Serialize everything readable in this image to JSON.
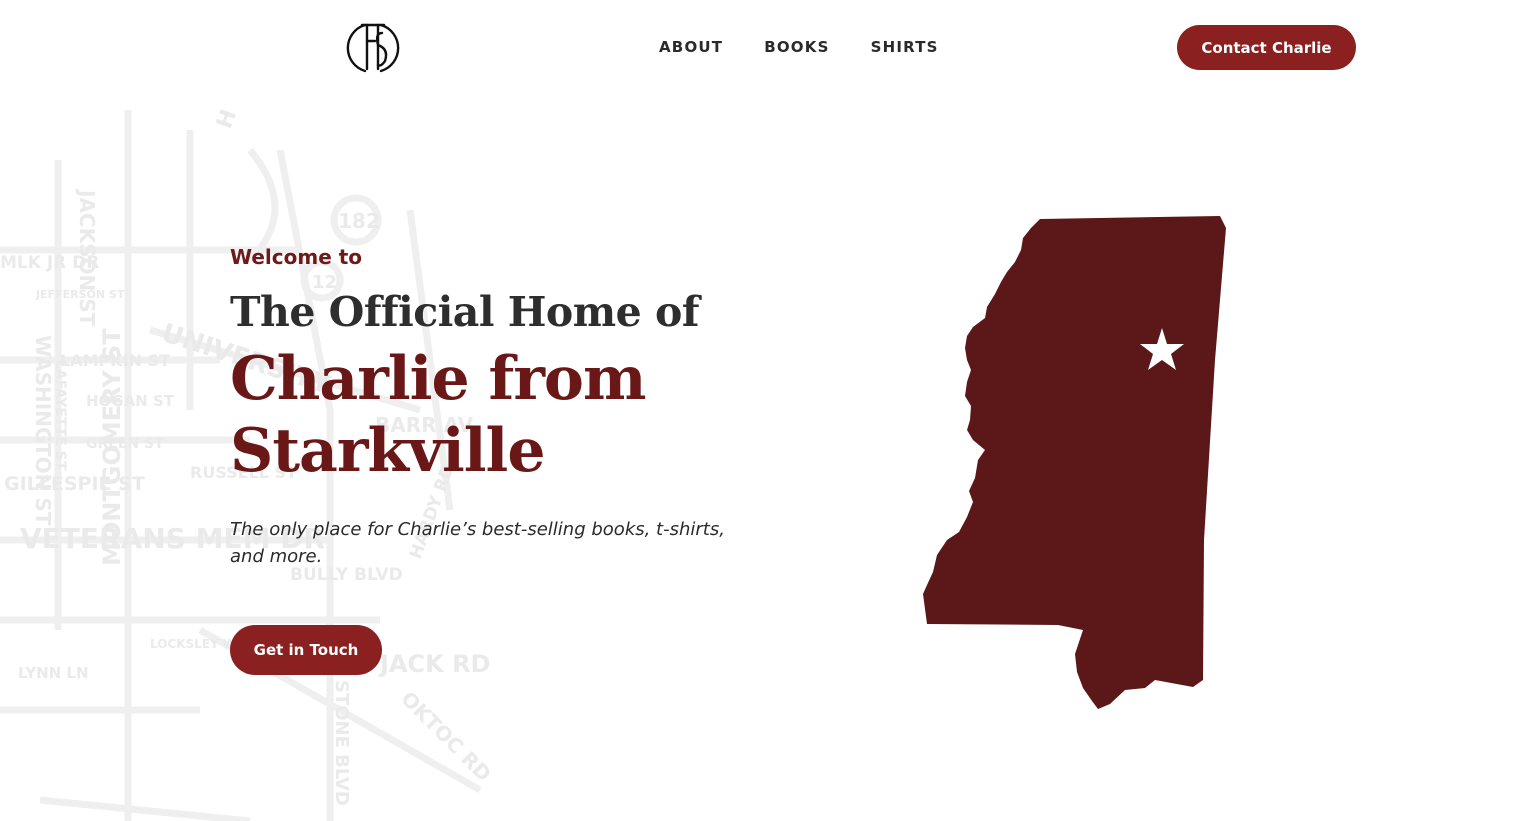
{
  "header": {
    "logo_icon": "cfs-monogram-logo-icon",
    "nav": [
      {
        "label": "ABOUT"
      },
      {
        "label": "BOOKS"
      },
      {
        "label": "SHIRTS"
      }
    ],
    "contact_button": "Contact Charlie"
  },
  "hero": {
    "eyebrow": "Welcome to",
    "title_line1": "The Official Home of",
    "title_line2": "Charlie from",
    "title_line3": "Starkville",
    "tagline": "The only place for Charlie’s best-selling books, t-shirts, and more.",
    "cta_button": "Get in Touch"
  },
  "background_map": {
    "street_labels": [
      "JACKSON ST",
      "MLK JR DR",
      "JEFFERSON ST",
      "HOLLYWEST POINT RD",
      "182",
      "UNIVERSITY",
      "12",
      "LAMPKIN ST",
      "WASHINGTON ST",
      "LAFAYETTE ST",
      "HOGAN ST",
      "BARR AV",
      "GREEN ST",
      "GILLESPIE ST",
      "RUSSELL ST",
      "VETERANS MEM DR",
      "MONTGOMERY ST",
      "BULLY BLVD",
      "HARDY RD",
      "LOCKSLEY WAY",
      "LYNN LN",
      "JACK RD",
      "STONE BLVD",
      "OKTOC RD"
    ]
  },
  "state_map": {
    "icon": "mississippi-state-map-icon",
    "marker_icon": "star-icon"
  },
  "colors": {
    "accent": "#8b2020",
    "map_fill": "#5c1818",
    "eyebrow": "#6e1a1a",
    "heading_dark": "#2e2e2e",
    "street_map": "#eeeeee"
  }
}
